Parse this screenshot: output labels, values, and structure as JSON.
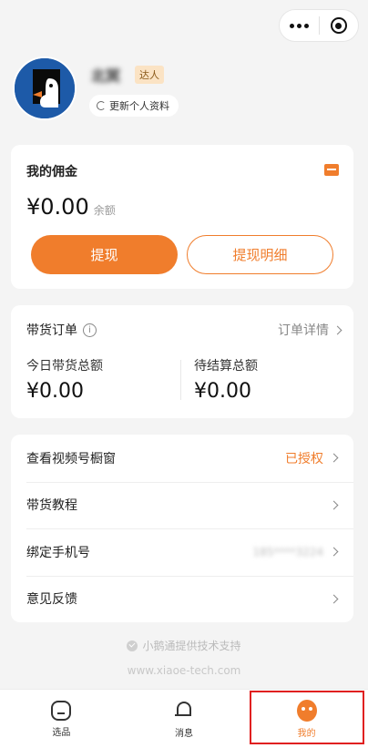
{
  "profile": {
    "nickname": "北冥",
    "badge": "达人",
    "update_label": "更新个人资料"
  },
  "commission": {
    "title": "我的佣金",
    "amount": "¥0.00",
    "amount_label": "余额",
    "withdraw_label": "提现",
    "withdraw_detail_label": "提现明细"
  },
  "orders": {
    "title": "带货订单",
    "detail_link": "订单详情",
    "today_label": "今日带货总额",
    "today_value": "¥0.00",
    "pending_label": "待结算总额",
    "pending_value": "¥0.00"
  },
  "menu": {
    "items": [
      {
        "label": "查看视频号橱窗",
        "value": "已授权"
      },
      {
        "label": "带货教程",
        "value": ""
      },
      {
        "label": "绑定手机号",
        "value": "185****3224"
      },
      {
        "label": "意见反馈",
        "value": ""
      }
    ]
  },
  "footer": {
    "support_text": "小鹅通提供技术支持",
    "url": "www.xiaoe-tech.com"
  },
  "tabbar": {
    "tabs": [
      {
        "label": "选品",
        "icon": "goods-icon"
      },
      {
        "label": "消息",
        "icon": "bell-icon"
      },
      {
        "label": "我的",
        "icon": "me-icon"
      }
    ]
  },
  "colors": {
    "accent": "#f07d2c",
    "highlight_box": "#e02020"
  }
}
